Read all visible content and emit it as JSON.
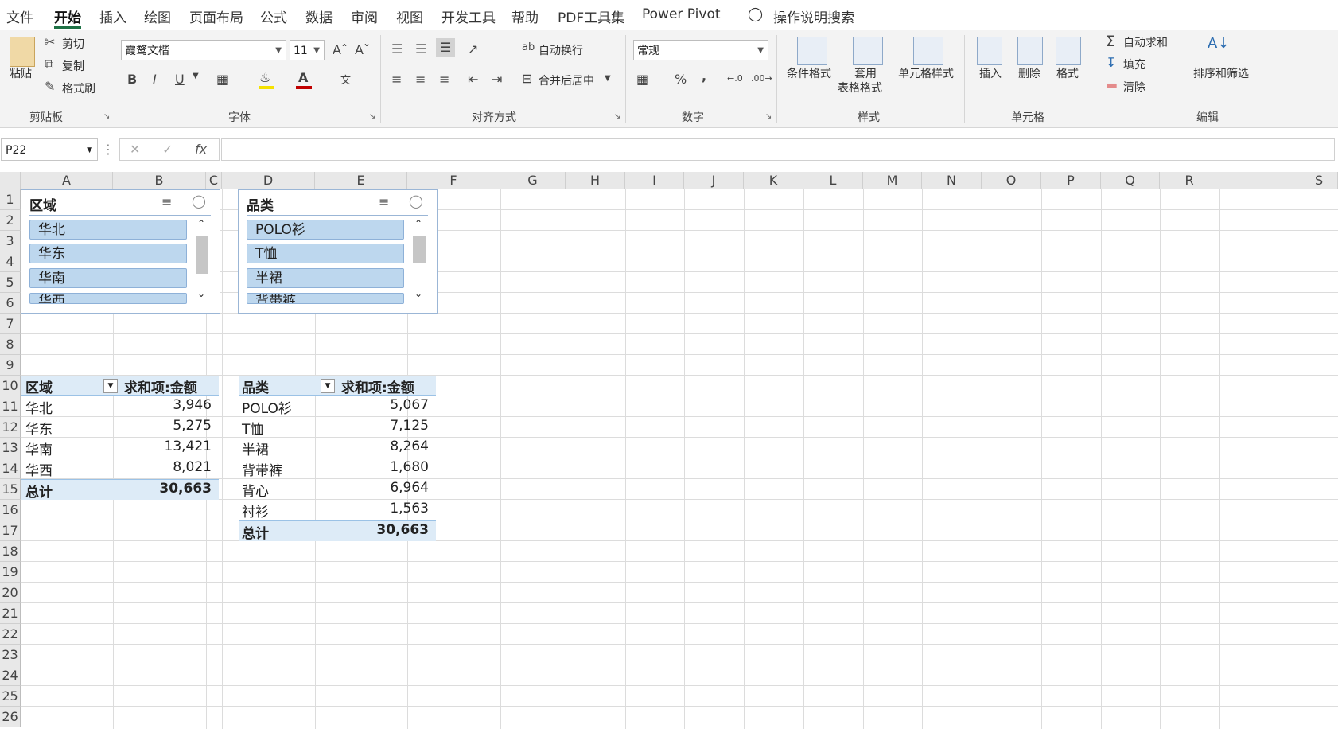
{
  "menu": {
    "tabs": [
      "文件",
      "开始",
      "插入",
      "绘图",
      "页面布局",
      "公式",
      "数据",
      "审阅",
      "视图",
      "开发工具",
      "帮助",
      "PDF工具集",
      "Power Pivot"
    ],
    "active_tab": "开始",
    "search_label": "操作说明搜索"
  },
  "ribbon": {
    "clipboard": {
      "paste": "粘贴",
      "cut": "剪切",
      "copy": "复制",
      "format_painter": "格式刷",
      "label": "剪贴板"
    },
    "font": {
      "name": "霞鹜文楷",
      "size": "11",
      "bold": "B",
      "italic": "I",
      "underline": "U",
      "label": "字体"
    },
    "alignment": {
      "wrap": "自动换行",
      "merge": "合并后居中",
      "label": "对齐方式"
    },
    "number": {
      "format": "常规",
      "percent": "%",
      "comma": ",",
      "label": "数字"
    },
    "styles": {
      "conditional": "条件格式",
      "table_1": "套用",
      "table_2": "表格格式",
      "cell_styles": "单元格样式",
      "label": "样式"
    },
    "cells": {
      "insert": "插入",
      "delete": "删除",
      "format": "格式",
      "label": "单元格"
    },
    "editing": {
      "autosum": "自动求和",
      "fill": "填充",
      "clear": "清除",
      "sort": "排序和筛选",
      "label": "编辑"
    }
  },
  "formula_bar": {
    "name_box": "P22",
    "fx": "fx",
    "cancel": "✕",
    "enter": "✓",
    "value": ""
  },
  "columns": [
    "A",
    "B",
    "C",
    "D",
    "E",
    "F",
    "G",
    "H",
    "I",
    "J",
    "K",
    "L",
    "M",
    "N",
    "O",
    "P",
    "Q",
    "R",
    "S"
  ],
  "rows": [
    "1",
    "2",
    "3",
    "4",
    "5",
    "6",
    "7",
    "8",
    "9",
    "10",
    "11",
    "12",
    "13",
    "14",
    "15",
    "16",
    "17",
    "18",
    "19",
    "20",
    "21",
    "22",
    "23",
    "24",
    "25",
    "26"
  ],
  "slicers": [
    {
      "title": "区域",
      "items": [
        "华北",
        "华东",
        "华南",
        "华西"
      ]
    },
    {
      "title": "品类",
      "items": [
        "POLO衫",
        "T恤",
        "半裙",
        "背带裤"
      ]
    }
  ],
  "pivot1": {
    "header": [
      "区域",
      "求和项:金额"
    ],
    "rows": [
      [
        "华北",
        "3,946"
      ],
      [
        "华东",
        "5,275"
      ],
      [
        "华南",
        "13,421"
      ],
      [
        "华西",
        "8,021"
      ]
    ],
    "total": [
      "总计",
      "30,663"
    ]
  },
  "pivot2": {
    "header": [
      "品类",
      "求和项:金额"
    ],
    "rows": [
      [
        "POLO衫",
        "5,067"
      ],
      [
        "T恤",
        "7,125"
      ],
      [
        "半裙",
        "8,264"
      ],
      [
        "背带裤",
        "1,680"
      ],
      [
        "背心",
        "6,964"
      ],
      [
        "衬衫",
        "1,563"
      ]
    ],
    "total": [
      "总计",
      "30,663"
    ]
  },
  "colors": {
    "accent": "#1e7145",
    "pivot_header": "#ddebf7",
    "slicer_item": "#bdd7ee"
  }
}
